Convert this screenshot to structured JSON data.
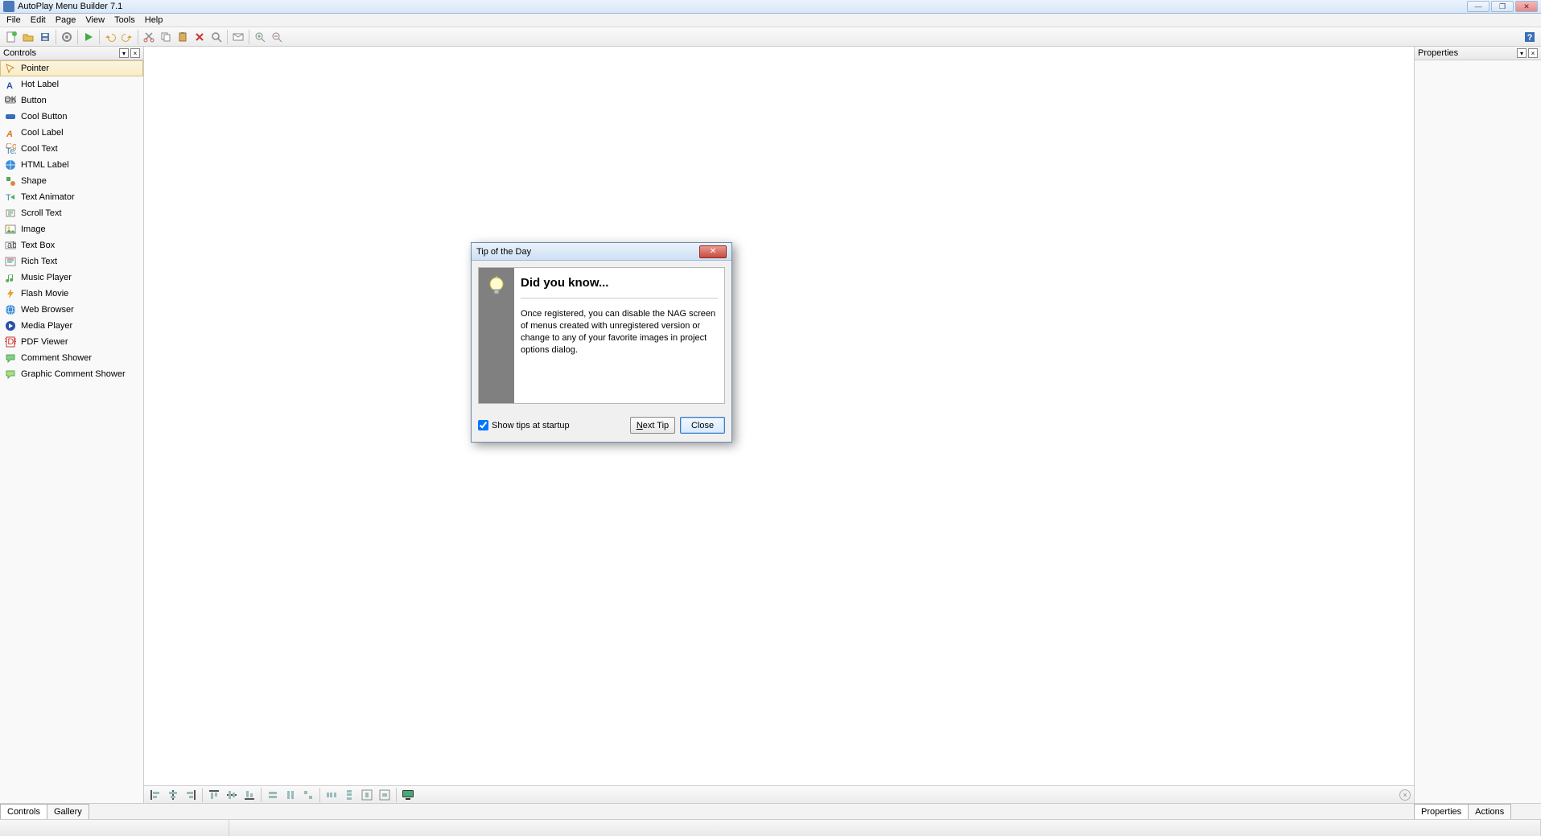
{
  "titlebar": {
    "title": "AutoPlay Menu Builder 7.1"
  },
  "menu": {
    "items": [
      "File",
      "Edit",
      "Page",
      "View",
      "Tools",
      "Help"
    ]
  },
  "toolbar": {
    "buttons": [
      {
        "name": "new-icon"
      },
      {
        "name": "open-icon"
      },
      {
        "name": "save-icon"
      },
      {
        "name": "sep"
      },
      {
        "name": "settings-icon"
      },
      {
        "name": "sep"
      },
      {
        "name": "play-icon"
      },
      {
        "name": "sep"
      },
      {
        "name": "undo-icon"
      },
      {
        "name": "redo-icon"
      },
      {
        "name": "sep"
      },
      {
        "name": "cut-icon"
      },
      {
        "name": "copy-icon"
      },
      {
        "name": "paste-icon"
      },
      {
        "name": "delete-icon"
      },
      {
        "name": "find-icon"
      },
      {
        "name": "sep"
      },
      {
        "name": "mail-icon"
      },
      {
        "name": "sep"
      },
      {
        "name": "zoom-in-icon"
      },
      {
        "name": "zoom-out-icon"
      }
    ]
  },
  "panels": {
    "controls": {
      "title": "Controls"
    },
    "properties": {
      "title": "Properties"
    }
  },
  "controls_list": [
    {
      "label": "Pointer",
      "icon": "pointer-icon",
      "selected": true
    },
    {
      "label": "Hot Label",
      "icon": "hot-label-icon"
    },
    {
      "label": "Button",
      "icon": "button-icon"
    },
    {
      "label": "Cool Button",
      "icon": "cool-button-icon"
    },
    {
      "label": "Cool Label",
      "icon": "cool-label-icon"
    },
    {
      "label": "Cool Text",
      "icon": "cool-text-icon"
    },
    {
      "label": "HTML Label",
      "icon": "html-label-icon"
    },
    {
      "label": "Shape",
      "icon": "shape-icon"
    },
    {
      "label": "Text Animator",
      "icon": "text-animator-icon"
    },
    {
      "label": "Scroll Text",
      "icon": "scroll-text-icon"
    },
    {
      "label": "Image",
      "icon": "image-icon"
    },
    {
      "label": "Text Box",
      "icon": "text-box-icon"
    },
    {
      "label": "Rich Text",
      "icon": "rich-text-icon"
    },
    {
      "label": "Music Player",
      "icon": "music-player-icon"
    },
    {
      "label": "Flash Movie",
      "icon": "flash-movie-icon"
    },
    {
      "label": "Web Browser",
      "icon": "web-browser-icon"
    },
    {
      "label": "Media Player",
      "icon": "media-player-icon"
    },
    {
      "label": "PDF Viewer",
      "icon": "pdf-viewer-icon"
    },
    {
      "label": "Comment Shower",
      "icon": "comment-shower-icon"
    },
    {
      "label": "Graphic Comment Shower",
      "icon": "graphic-comment-shower-icon"
    }
  ],
  "bottom_tabs_left": [
    "Controls",
    "Gallery"
  ],
  "bottom_tabs_right": [
    "Properties",
    "Actions"
  ],
  "dialog": {
    "title": "Tip of the Day",
    "heading": "Did you know...",
    "body": "Once registered, you can disable the NAG screen of menus created with unregistered version or change to any of your favorite images in project options dialog.",
    "show_tips_label": "Show tips at startup",
    "show_tips_checked": true,
    "next_tip_label": "Next Tip",
    "close_label": "Close"
  }
}
